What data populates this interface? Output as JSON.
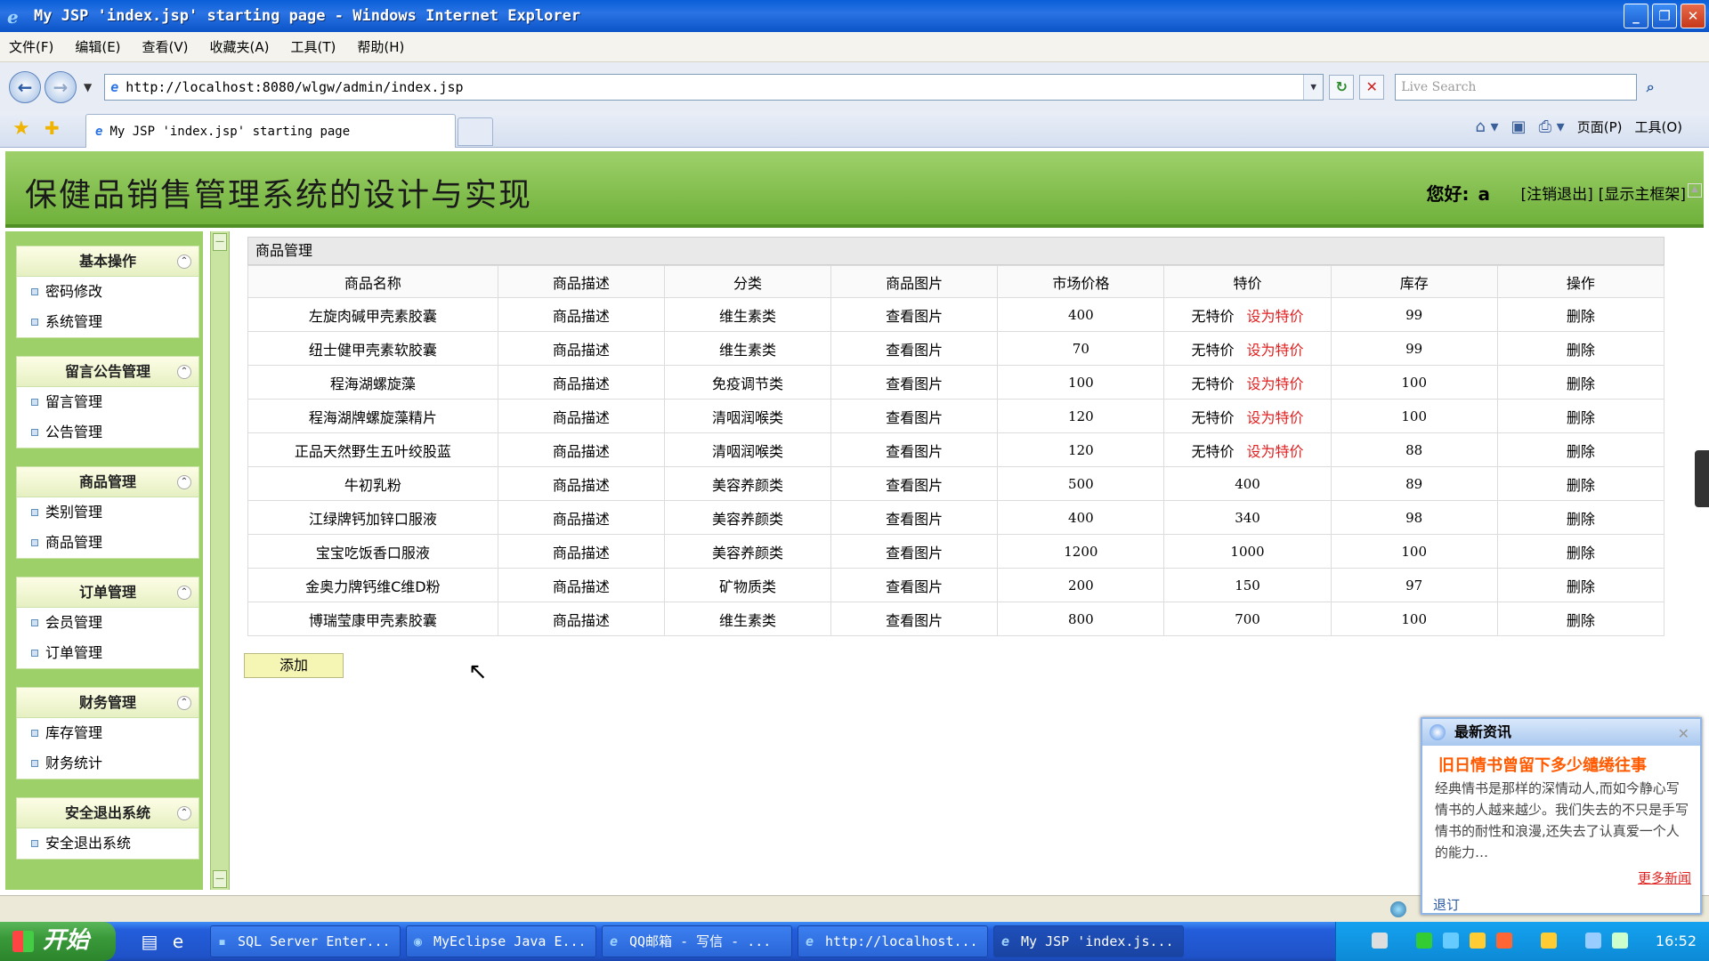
{
  "window": {
    "title": "My JSP 'index.jsp' starting page - Windows Internet Explorer"
  },
  "menu": [
    "文件(F)",
    "编辑(E)",
    "查看(V)",
    "收藏夹(A)",
    "工具(T)",
    "帮助(H)"
  ],
  "address": {
    "url": "http://localhost:8080/wlgw/admin/index.jsp",
    "search_placeholder": "Live Search"
  },
  "tab": {
    "label": "My JSP 'index.jsp' starting page"
  },
  "commands": {
    "page": "页面(P)",
    "tools": "工具(O)"
  },
  "header": {
    "title": "保健品销售管理系统的设计与实现",
    "greeting": "您好:",
    "user": "a",
    "logout": "[注销退出]",
    "show_frame": "[显示主框架]"
  },
  "sidebar": {
    "groups": [
      {
        "title": "基本操作",
        "items": [
          "密码修改",
          "系统管理"
        ]
      },
      {
        "title": "留言公告管理",
        "items": [
          "留言管理",
          "公告管理"
        ]
      },
      {
        "title": "商品管理",
        "items": [
          "类别管理",
          "商品管理"
        ]
      },
      {
        "title": "订单管理",
        "items": [
          "会员管理",
          "订单管理"
        ]
      },
      {
        "title": "财务管理",
        "items": [
          "库存管理",
          "财务统计"
        ]
      },
      {
        "title": "安全退出系统",
        "items": [
          "安全退出系统"
        ]
      }
    ]
  },
  "main": {
    "section_title": "商品管理",
    "columns": [
      "商品名称",
      "商品描述",
      "分类",
      "商品图片",
      "市场价格",
      "特价",
      "库存",
      "操作"
    ],
    "rows": [
      {
        "name": "左旋肉碱甲壳素胶囊",
        "desc": "商品描述",
        "category": "维生素类",
        "image": "查看图片",
        "price": "400",
        "special": "无特价",
        "set_special": "设为特价",
        "stock": "99",
        "action": "删除"
      },
      {
        "name": "纽士健甲壳素软胶囊",
        "desc": "商品描述",
        "category": "维生素类",
        "image": "查看图片",
        "price": "70",
        "special": "无特价",
        "set_special": "设为特价",
        "stock": "99",
        "action": "删除"
      },
      {
        "name": "程海湖螺旋藻",
        "desc": "商品描述",
        "category": "免疫调节类",
        "image": "查看图片",
        "price": "100",
        "special": "无特价",
        "set_special": "设为特价",
        "stock": "100",
        "action": "删除"
      },
      {
        "name": "程海湖牌螺旋藻精片",
        "desc": "商品描述",
        "category": "清咽润喉类",
        "image": "查看图片",
        "price": "120",
        "special": "无特价",
        "set_special": "设为特价",
        "stock": "100",
        "action": "删除"
      },
      {
        "name": "正品天然野生五叶绞股蓝",
        "desc": "商品描述",
        "category": "清咽润喉类",
        "image": "查看图片",
        "price": "120",
        "special": "无特价",
        "set_special": "设为特价",
        "stock": "88",
        "action": "删除"
      },
      {
        "name": "牛初乳粉",
        "desc": "商品描述",
        "category": "美容养颜类",
        "image": "查看图片",
        "price": "500",
        "special": "400",
        "set_special": "",
        "stock": "89",
        "action": "删除"
      },
      {
        "name": "江绿牌钙加锌口服液",
        "desc": "商品描述",
        "category": "美容养颜类",
        "image": "查看图片",
        "price": "400",
        "special": "340",
        "set_special": "",
        "stock": "98",
        "action": "删除"
      },
      {
        "name": "宝宝吃饭香口服液",
        "desc": "商品描述",
        "category": "美容养颜类",
        "image": "查看图片",
        "price": "1200",
        "special": "1000",
        "set_special": "",
        "stock": "100",
        "action": "删除"
      },
      {
        "name": "金奥力牌钙维C维D粉",
        "desc": "商品描述",
        "category": "矿物质类",
        "image": "查看图片",
        "price": "200",
        "special": "150",
        "set_special": "",
        "stock": "97",
        "action": "删除"
      },
      {
        "name": "博瑞莹康甲壳素胶囊",
        "desc": "商品描述",
        "category": "维生素类",
        "image": "查看图片",
        "price": "800",
        "special": "700",
        "set_special": "",
        "stock": "100",
        "action": "删除"
      }
    ],
    "add_label": "添加"
  },
  "popup": {
    "title": "最新资讯",
    "headline": "旧日情书曾留下多少缱绻往事",
    "body": "经典情书是那样的深情动人,而如今静心写情书的人越来越少。我们失去的不只是手写情书的耐性和浪漫,还失去了认真爱一个人的能力…",
    "more": "更多新闻",
    "unsubscribe": "退订"
  },
  "taskbar": {
    "start": "开始",
    "tasks": [
      "SQL Server Enter...",
      "MyEclipse Java E...",
      "QQ邮箱 - 写信 - ...",
      "http://localhost...",
      "My JSP 'index.js..."
    ],
    "clock": "16:52"
  }
}
